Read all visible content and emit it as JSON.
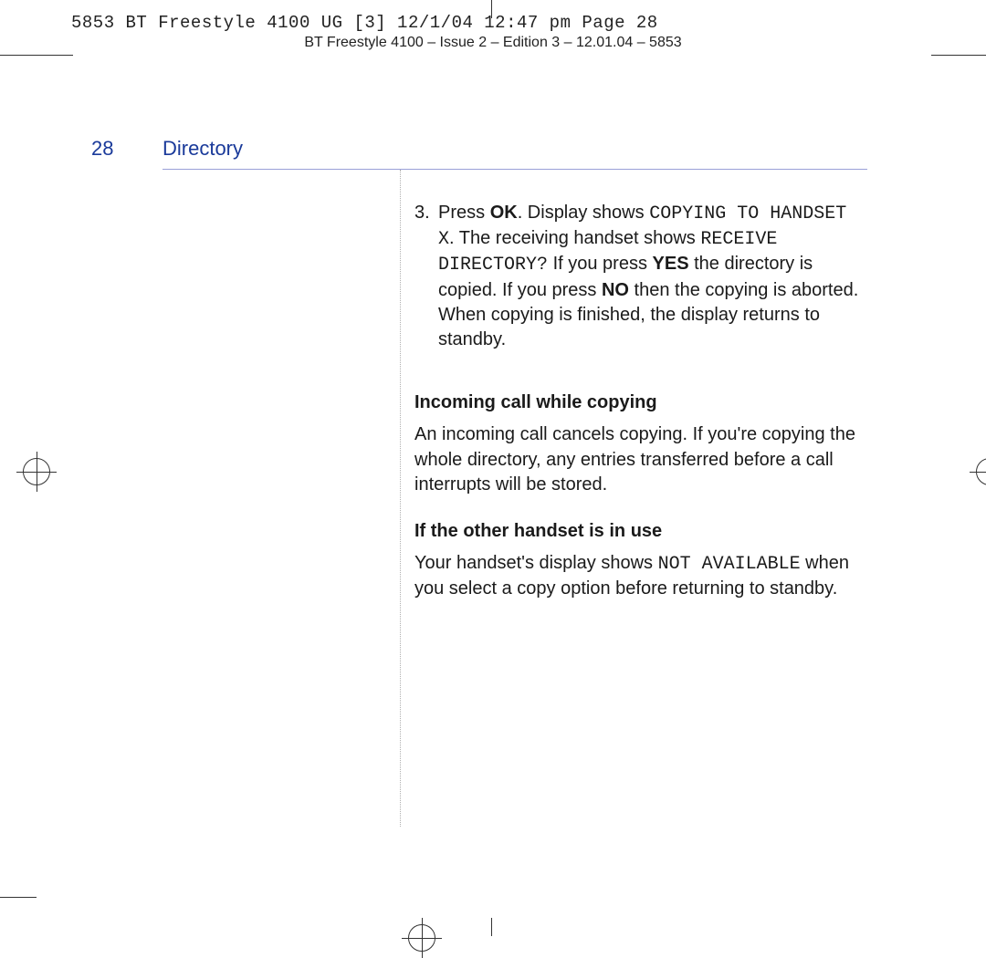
{
  "print_slug": "5853 BT Freestyle 4100 UG [3]  12/1/04  12:47 pm  Page 28",
  "print_header": "BT Freestyle 4100 – Issue 2 – Edition 3 – 12.01.04 – 5853",
  "page_number": "28",
  "section_title": "Directory",
  "step3": {
    "num": "3.",
    "pre": "Press ",
    "ok": "OK",
    "t1": ". Display shows ",
    "lcd1": "COPYING TO HANDSET X",
    "t2": ". The receiving handset shows ",
    "lcd2": "RECEIVE DIRECTORY?",
    "t3": " If you press ",
    "yes": "YES",
    "t4": " the directory is copied. If you press ",
    "no": "NO",
    "t5": " then the copying is aborted. When copying is finished, the display returns to standby."
  },
  "sub1_h": "Incoming call while copying",
  "sub1_p": "An incoming call cancels copying. If you're copying the whole directory, any entries transferred before a call interrupts will be stored.",
  "sub2_h": "If the other handset is in use",
  "sub2": {
    "t1": "Your handset's display shows ",
    "lcd": "NOT AVAILABLE",
    "t2": " when you select a copy option before returning to standby."
  }
}
